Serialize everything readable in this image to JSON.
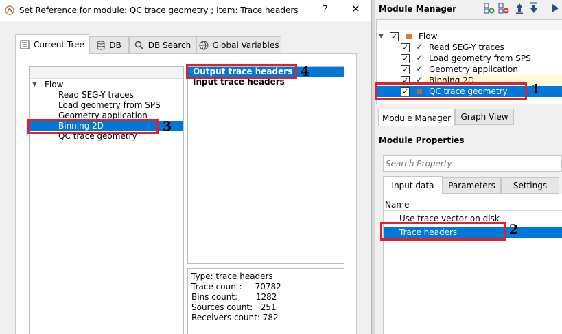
{
  "dialog": {
    "title": "Set Reference for module: QC trace geometry ; Item: Trace headers",
    "help_label": "?",
    "close_label": "✕",
    "tabs": [
      {
        "label": "Current Tree"
      },
      {
        "label": "DB"
      },
      {
        "label": "DB Search"
      },
      {
        "label": "Global Variables"
      }
    ],
    "tree": {
      "root": "Flow",
      "items": [
        {
          "label": "Read SEG-Y traces"
        },
        {
          "label": "Load geometry from SPS"
        },
        {
          "label": "Geometry application"
        },
        {
          "label": "Binning 2D"
        },
        {
          "label": "QC trace geometry"
        }
      ]
    },
    "items_list": [
      {
        "label": "Output trace headers"
      },
      {
        "label": "Input trace headers"
      }
    ],
    "info": [
      {
        "label": "Type: trace headers"
      },
      {
        "label": "Trace count:     70782"
      },
      {
        "label": "Bins count:       1282"
      },
      {
        "label": "Sources count:   251"
      },
      {
        "label": "Receivers count: 782"
      }
    ]
  },
  "module_manager": {
    "title": "Module Manager",
    "flow_root": "Flow",
    "modules": [
      {
        "label": "Read SEG-Y traces"
      },
      {
        "label": "Load geometry from SPS"
      },
      {
        "label": "Geometry application"
      },
      {
        "label": "Binning 2D"
      },
      {
        "label": "QC trace geometry"
      }
    ],
    "bottom_tabs": [
      {
        "label": "Module Manager"
      },
      {
        "label": "Graph View"
      }
    ]
  },
  "module_properties": {
    "title": "Module Properties",
    "search_placeholder": "Search Property",
    "tabs": [
      {
        "label": "Input data"
      },
      {
        "label": "Parameters"
      },
      {
        "label": "Settings"
      }
    ],
    "column_header": "Name",
    "rows": [
      {
        "label": "Use trace vector on disk"
      },
      {
        "label": "Trace headers"
      }
    ]
  },
  "annotations": {
    "n1": "1",
    "n2": "2",
    "n3": "3",
    "n4": "4"
  },
  "colors": {
    "selection": "#0078d7",
    "highlight_box": "#e0202a",
    "module_square": "#e07a2e"
  }
}
